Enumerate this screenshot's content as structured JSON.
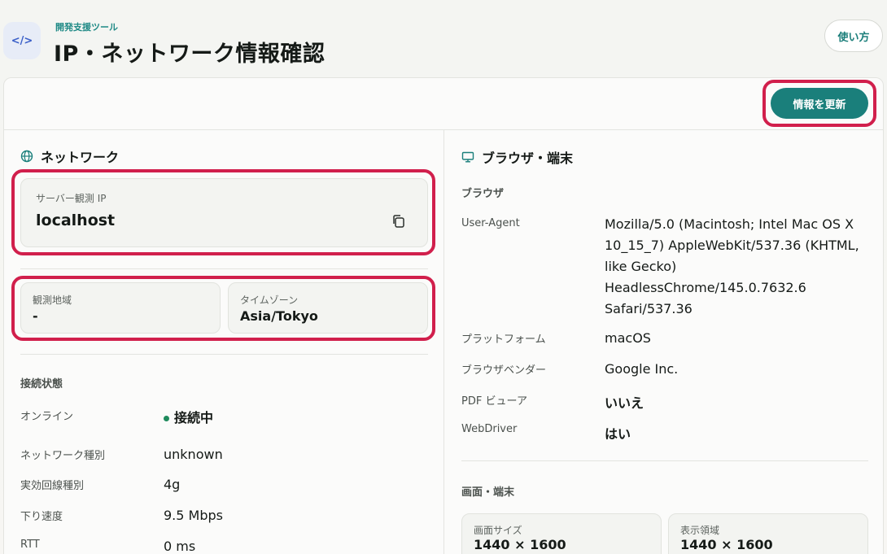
{
  "header": {
    "icon": "code-icon",
    "kicker": "開発支援ツール",
    "title": "IP・ネットワーク情報確認",
    "help_label": "使い方"
  },
  "toolbar": {
    "refresh_label": "情報を更新"
  },
  "network": {
    "title": "ネットワーク",
    "icon": "globe-icon",
    "server_ip_label": "サーバー観測 IP",
    "server_ip_value": "localhost",
    "region_label": "観測地域",
    "region_value": "-",
    "timezone_label": "タイムゾーン",
    "timezone_value": "Asia/Tokyo",
    "connection_heading": "接続状態",
    "rows": [
      {
        "key": "オンライン",
        "value": "接続中"
      },
      {
        "key": "ネットワーク種別",
        "value": "unknown"
      },
      {
        "key": "実効回線種別",
        "value": "4g"
      },
      {
        "key": "下り速度",
        "value": "9.5 Mbps"
      },
      {
        "key": "RTT",
        "value": "0 ms"
      }
    ],
    "online_color": "#1f8a5c"
  },
  "browser": {
    "title": "ブラウザ・端末",
    "icon": "monitor-icon",
    "browser_heading": "ブラウザ",
    "rows": [
      {
        "key": "User-Agent",
        "value": "Mozilla/5.0 (Macintosh; Intel Mac OS X 10_15_7) AppleWebKit/537.36 (KHTML, like Gecko) HeadlessChrome/145.0.7632.6 Safari/537.36"
      },
      {
        "key": "プラットフォーム",
        "value": "macOS"
      },
      {
        "key": "ブラウザベンダー",
        "value": "Google Inc."
      },
      {
        "key": "PDF ビューア",
        "value": "いいえ"
      },
      {
        "key": "WebDriver",
        "value": "はい"
      }
    ],
    "screen_heading": "画面・端末",
    "screen_size_label": "画面サイズ",
    "screen_size_value": "1440 × 1600",
    "viewport_label": "表示領域",
    "viewport_value": "1440 × 1600"
  },
  "colors": {
    "accent": "#1a7f7b",
    "highlight": "#d11f4c"
  }
}
